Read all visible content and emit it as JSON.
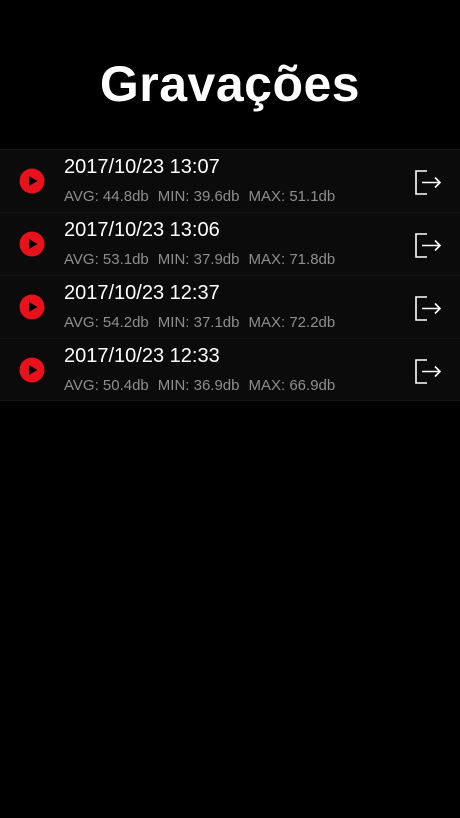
{
  "header": {
    "title": "Gravações"
  },
  "colors": {
    "accent": "#e8111c",
    "background": "#000000",
    "row_background": "#0b0b0b",
    "secondary_text": "#8e8e8e"
  },
  "icons": {
    "play": "play-circle-icon",
    "export": "export-icon"
  },
  "recordings": [
    {
      "date": "2017/10/23 13:07",
      "avg": "AVG: 44.8db",
      "min": "MIN: 39.6db",
      "max": "MAX: 51.1db"
    },
    {
      "date": "2017/10/23 13:06",
      "avg": "AVG: 53.1db",
      "min": "MIN: 37.9db",
      "max": "MAX: 71.8db"
    },
    {
      "date": "2017/10/23 12:37",
      "avg": "AVG: 54.2db",
      "min": "MIN: 37.1db",
      "max": "MAX: 72.2db"
    },
    {
      "date": "2017/10/23 12:33",
      "avg": "AVG: 50.4db",
      "min": "MIN: 36.9db",
      "max": "MAX: 66.9db"
    }
  ]
}
